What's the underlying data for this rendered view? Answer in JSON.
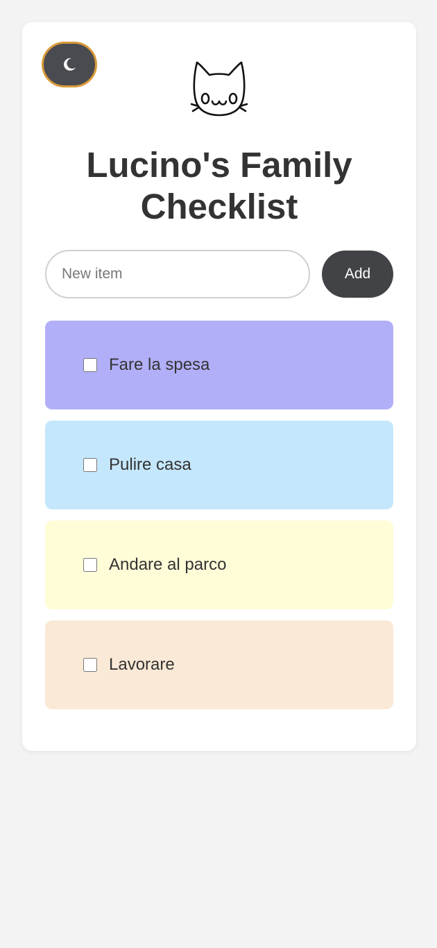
{
  "header": {
    "title": "Lucino's Family Checklist",
    "theme_toggle_icon": "moon-icon",
    "logo_icon": "cat-face-icon"
  },
  "form": {
    "input_placeholder": "New item",
    "input_value": "",
    "add_label": "Add"
  },
  "items": [
    {
      "label": "Fare la spesa",
      "checked": false,
      "color": "#b2aff9"
    },
    {
      "label": "Pulire casa",
      "checked": false,
      "color": "#c5e7fb"
    },
    {
      "label": "Andare al parco",
      "checked": false,
      "color": "#fffcd8"
    },
    {
      "label": "Lavorare",
      "checked": false,
      "color": "#fae9d6"
    }
  ],
  "colors": {
    "background": "#f3f3f3",
    "card": "#ffffff",
    "toggle_bg": "#4a4b50",
    "toggle_border": "#d99a3a",
    "button_bg": "#424347",
    "text": "#333333"
  }
}
